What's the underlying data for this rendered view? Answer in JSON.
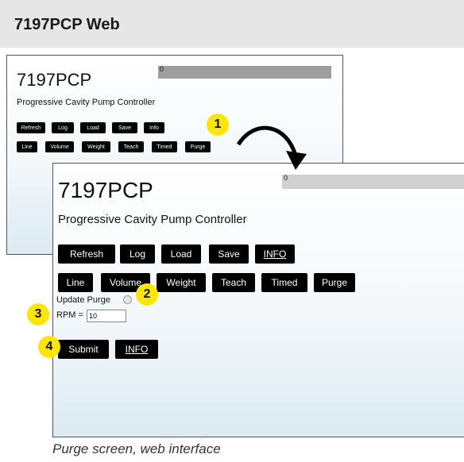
{
  "header": {
    "title": "7197PCP Web"
  },
  "app": {
    "title": "7197PCP",
    "subtitle": "Progressive Cavity Pump Controller",
    "progress_value": "0",
    "row1": [
      "Refresh",
      "Log",
      "Load",
      "Save"
    ],
    "info_back": "Info",
    "info_front": "INFO",
    "row2": [
      "Line",
      "Volume",
      "Weight",
      "Teach",
      "Timed",
      "Purge"
    ]
  },
  "purge": {
    "update_label": "Update Purge",
    "rpm_label": "RPM =",
    "rpm_value": "10",
    "submit": "Submit",
    "info": "INFO"
  },
  "callouts": [
    "1",
    "2",
    "3",
    "4"
  ],
  "caption": "Purge screen, web interface",
  "colors": {
    "callout": "#ffe600",
    "button": "#000000",
    "header_bg": "#e6e6e6"
  }
}
